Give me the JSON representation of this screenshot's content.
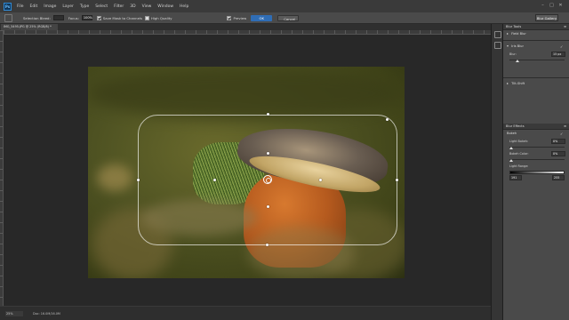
{
  "menu": {
    "logo": "Ps",
    "items": [
      "File",
      "Edit",
      "Image",
      "Layer",
      "Type",
      "Select",
      "Filter",
      "3D",
      "View",
      "Window",
      "Help"
    ]
  },
  "options_bar": {
    "selection_bleed_label": "Selection Bleed:",
    "selection_bleed_value": "",
    "focus_label": "Focus:",
    "focus_value": "100%",
    "save_mask_label": "Save Mask to Channels",
    "high_quality_label": "High Quality",
    "preview_label": "Preview",
    "ok_label": "OK",
    "cancel_label": "Cancel",
    "blur_gallery_label": "Blur Gallery"
  },
  "document": {
    "tab_title": "IMG_5495.JPG @ 25% (RGB/8) *",
    "zoom": "25%",
    "doc_info": "Doc: 16.0M/16.0M"
  },
  "blur_tools": {
    "title": "Blur Tools",
    "field_blur": "Field Blur",
    "iris_blur": "Iris Blur",
    "iris_checked": true,
    "blur_label": "Blur:",
    "blur_value": "15 px",
    "blur_fraction": 0.12,
    "tilt_shift": "Tilt-Shift"
  },
  "blur_effects": {
    "title": "Blur Effects",
    "bokeh_label": "Bokeh",
    "light_bokeh_label": "Light Bokeh:",
    "light_bokeh_value": "0%",
    "light_bokeh_fraction": 0.0,
    "bokeh_color_label": "Bokeh Color:",
    "bokeh_color_value": "0%",
    "bokeh_color_fraction": 0.0,
    "light_range_label": "Light Range:",
    "range_low": "191",
    "range_high": "255"
  },
  "colors": {
    "accent": "#2f6db5",
    "panel_bg": "#4a4a4a",
    "workspace": "#282828"
  }
}
